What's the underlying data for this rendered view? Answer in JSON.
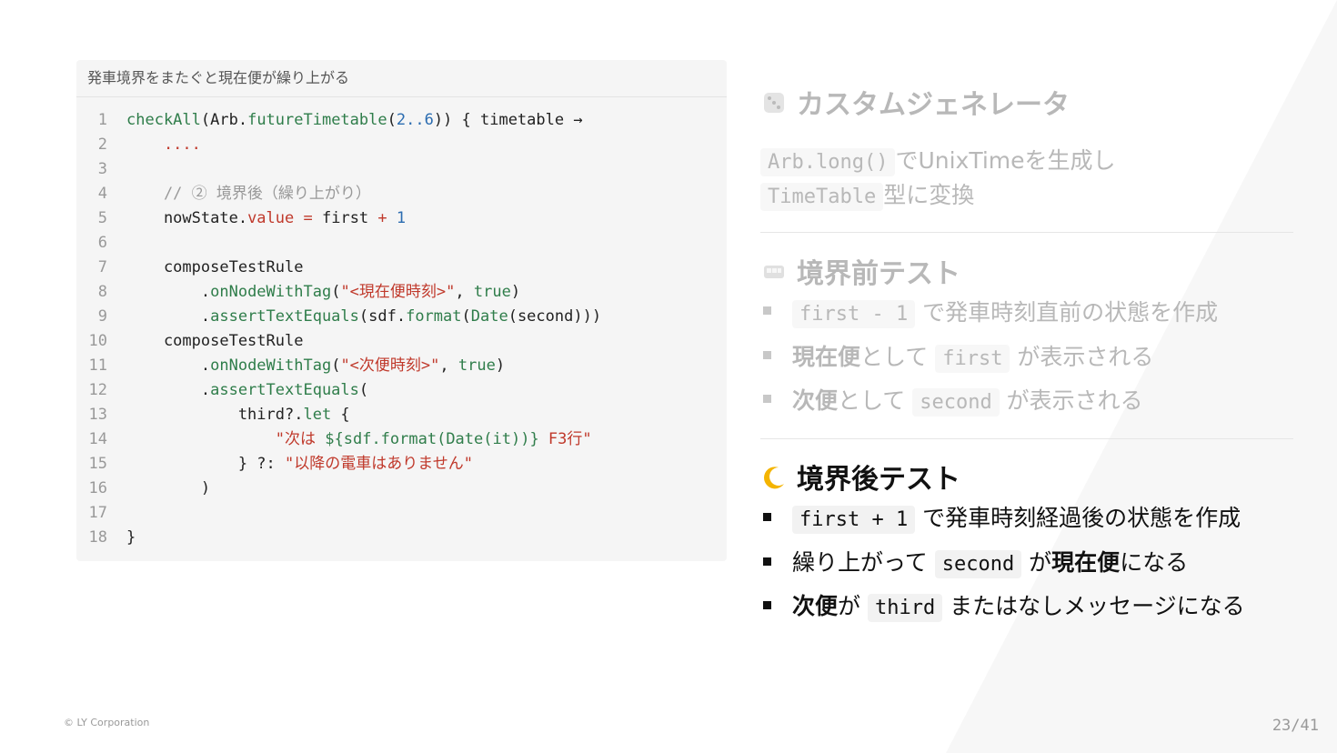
{
  "code": {
    "caption": "発車境界をまたぐと現在便が繰り上がる",
    "lines": [
      {
        "n": "1"
      },
      {
        "n": "2"
      },
      {
        "n": "3"
      },
      {
        "n": "4"
      },
      {
        "n": "5"
      },
      {
        "n": "6"
      },
      {
        "n": "7"
      },
      {
        "n": "8"
      },
      {
        "n": "9"
      },
      {
        "n": "10"
      },
      {
        "n": "11"
      },
      {
        "n": "12"
      },
      {
        "n": "13"
      },
      {
        "n": "14"
      },
      {
        "n": "15"
      },
      {
        "n": "16"
      },
      {
        "n": "17"
      },
      {
        "n": "18"
      }
    ]
  },
  "sections": {
    "custom_gen": {
      "title": "カスタムジェネレータ",
      "icon": "dice-icon",
      "line1_code": "Arb.long()",
      "line1_text": "でUnixTimeを生成し",
      "line2_code": "TimeTable",
      "line2_text": "型に変換"
    },
    "before": {
      "title": "境界前テスト",
      "icon": "train-icon",
      "b1_code": "first - 1",
      "b1_text": "で発車時刻直前の状態を作成",
      "b2_bold": "現在便",
      "b2_mid": "として",
      "b2_code": "first",
      "b2_end": "が表示される",
      "b3_bold": "次便",
      "b3_mid": "として",
      "b3_code": "second",
      "b3_end": "が表示される"
    },
    "after": {
      "title": "境界後テスト",
      "icon": "moon-icon",
      "b1_code": "first + 1",
      "b1_text": "で発車時刻経過後の状態を作成",
      "b2_pre": "繰り上がって",
      "b2_code": "second",
      "b2_mid": "が",
      "b2_bold": "現在便",
      "b2_end": "になる",
      "b3_bold": "次便",
      "b3_mid": "が",
      "b3_code": "third",
      "b3_end": "またはなしメッセージになる"
    }
  },
  "footer": {
    "copyright": "© LY Corporation",
    "page": "23/41"
  }
}
